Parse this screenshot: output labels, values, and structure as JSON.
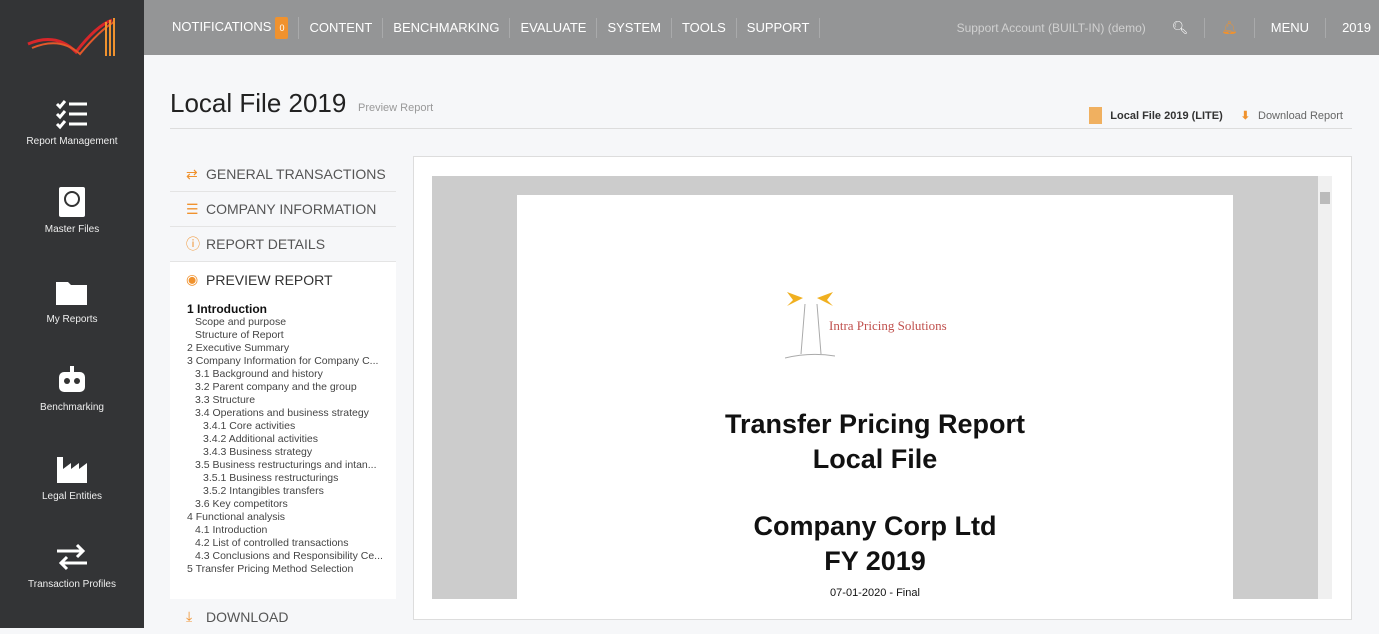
{
  "sidebar": {
    "items": [
      {
        "label": "Report Management",
        "icon": "checklist-icon"
      },
      {
        "label": "Master Files",
        "icon": "globe-book-icon"
      },
      {
        "label": "My Reports",
        "icon": "folder-icon"
      },
      {
        "label": "Benchmarking",
        "icon": "robot-icon"
      },
      {
        "label": "Legal Entities",
        "icon": "factory-icon"
      },
      {
        "label": "Transaction Profiles",
        "icon": "swap-icon"
      }
    ]
  },
  "topbar": {
    "nav": [
      "NOTIFICATIONS",
      "CONTENT",
      "BENCHMARKING",
      "EVALUATE",
      "SYSTEM",
      "TOOLS",
      "SUPPORT"
    ],
    "notification_count": "0",
    "account": "Support Account (BUILT-IN) (demo)",
    "menu": "MENU",
    "year": "2019"
  },
  "header": {
    "title": "Local File 2019",
    "subtitle": "Preview Report",
    "file_label": "Local File 2019 (LITE)",
    "download": "Download Report"
  },
  "sections": [
    "GENERAL TRANSACTIONS",
    "COMPANY INFORMATION",
    "REPORT DETAILS",
    "PREVIEW REPORT",
    "DOWNLOAD"
  ],
  "toc": [
    {
      "t": "1 Introduction",
      "l": 0
    },
    {
      "t": "Scope and purpose",
      "l": 1
    },
    {
      "t": "Structure of Report",
      "l": 1
    },
    {
      "t": "2 Executive Summary",
      "l": 0
    },
    {
      "t": "3 Company Information for Company C...",
      "l": 0
    },
    {
      "t": "3.1 Background and history",
      "l": 1
    },
    {
      "t": "3.2 Parent company and the group",
      "l": 1
    },
    {
      "t": "3.3 Structure",
      "l": 1
    },
    {
      "t": "3.4 Operations and business strategy",
      "l": 1
    },
    {
      "t": "3.4.1 Core activities",
      "l": 2
    },
    {
      "t": "3.4.2 Additional activities",
      "l": 2
    },
    {
      "t": "3.4.3 Business strategy",
      "l": 2
    },
    {
      "t": "3.5 Business restructurings and intan...",
      "l": 1
    },
    {
      "t": "3.5.1 Business restructurings",
      "l": 2
    },
    {
      "t": "3.5.2 Intangibles transfers",
      "l": 2
    },
    {
      "t": "3.6 Key competitors",
      "l": 1
    },
    {
      "t": "4 Functional analysis",
      "l": 0
    },
    {
      "t": "4.1 Introduction",
      "l": 1
    },
    {
      "t": "4.2 List of controlled transactions",
      "l": 1
    },
    {
      "t": "4.3 Conclusions and Responsibility Ce...",
      "l": 1
    },
    {
      "t": "5 Transfer Pricing Method Selection",
      "l": 0
    }
  ],
  "document": {
    "logo_text": "Intra Pricing Solutions",
    "title1": "Transfer Pricing Report",
    "title2": "Local File",
    "company": "Company Corp Ltd",
    "fy": "FY 2019",
    "date": "07-01-2020 - Final"
  },
  "colors": {
    "accent": "#f0922e",
    "sidebar": "#333436",
    "topbar": "#949596"
  }
}
